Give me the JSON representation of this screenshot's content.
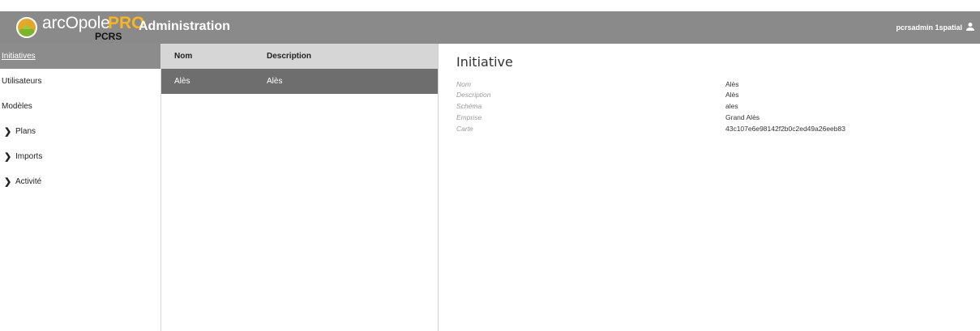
{
  "header": {
    "logo_text": "arcOpole",
    "logo_pro": "PRO",
    "logo_sub": "PCRS",
    "app_title": "Administration",
    "user_name": "pcrsadmin 1spatial",
    "user_icon": "user-icon"
  },
  "sidebar": {
    "items": [
      {
        "label": "Initiatives",
        "active": true,
        "expandable": false
      },
      {
        "label": "Utilisateurs",
        "active": false,
        "expandable": false
      },
      {
        "label": "Modèles",
        "active": false,
        "expandable": false
      },
      {
        "label": "Plans",
        "active": false,
        "expandable": true
      },
      {
        "label": "Imports",
        "active": false,
        "expandable": true
      },
      {
        "label": "Activité",
        "active": false,
        "expandable": true
      }
    ]
  },
  "list": {
    "columns": [
      "Nom",
      "Description"
    ],
    "rows": [
      {
        "nom": "Alès",
        "description": "Alès"
      }
    ]
  },
  "detail": {
    "title": "Initiative",
    "fields": [
      {
        "label": "Nom",
        "value": "Alès"
      },
      {
        "label": "Description",
        "value": "Alès"
      },
      {
        "label": "Schéma",
        "value": "ales"
      },
      {
        "label": "Emprise",
        "value": "Grand Alès"
      },
      {
        "label": "Carte",
        "value": "43c107e6e98142f2b0c2ed49a26eeb83"
      }
    ]
  },
  "colors": {
    "header_bg": "#8a8a8a",
    "active_bg": "#8c8c8c",
    "selected_row_bg": "#6e6e6e",
    "logo_accent": "#f6b521"
  }
}
